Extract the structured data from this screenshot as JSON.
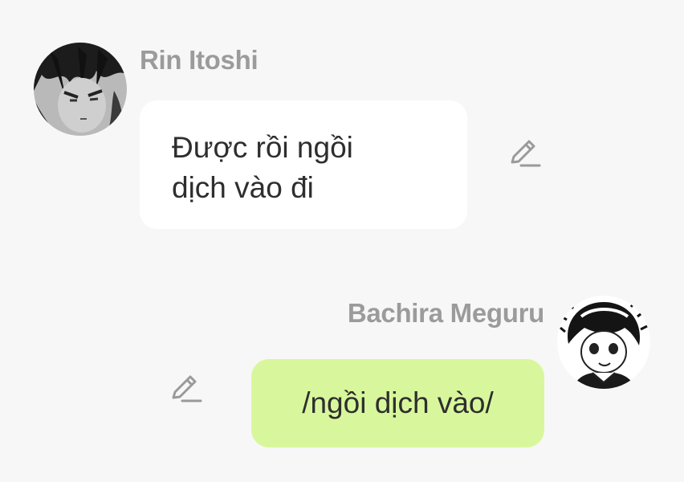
{
  "chat": {
    "messages": [
      {
        "sender": "Rin Itoshi",
        "avatar_icon": "manga-avatar-rin",
        "side": "left",
        "text_lines": [
          "Được rồi ngồi",
          "dịch vào đi"
        ],
        "bubble_color": "#ffffff",
        "action_icon": "pencil-edit-icon"
      },
      {
        "sender": "Bachira Meguru",
        "avatar_icon": "manga-avatar-bachira",
        "side": "right",
        "text": "/ngồi dịch vào/",
        "bubble_color": "#d8f79c",
        "action_icon": "pencil-edit-icon"
      }
    ]
  },
  "colors": {
    "background": "#f7f7f7",
    "name_text": "#9b9b9b",
    "message_text": "#2e2e2e",
    "icon": "#9a9a9a"
  }
}
